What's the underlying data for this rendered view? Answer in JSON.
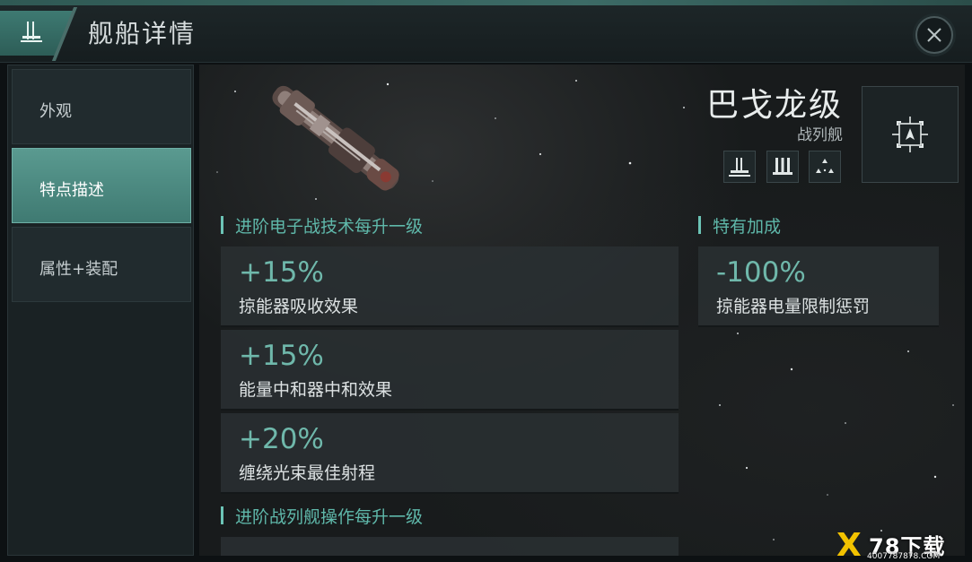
{
  "window": {
    "title": "舰船详情",
    "emblem_icon": "battleship-class-emblem-icon",
    "close_icon": "close-icon"
  },
  "sidebar": {
    "tabs": [
      {
        "label": "外观",
        "active": false
      },
      {
        "label": "特点描述",
        "active": true
      },
      {
        "label": "属性+装配",
        "active": false
      }
    ]
  },
  "ship": {
    "name": "巴戈龙级",
    "class": "战列舰",
    "role_icons": [
      "battleship-silhouette-icon",
      "triple-hull-icon",
      "fleet-formation-icon"
    ],
    "nav_icon": "target-navigate-icon"
  },
  "sections": {
    "skill_bonus_1": {
      "heading": "进阶电子战技术每升一级",
      "bonuses": [
        {
          "value": "+15%",
          "desc": "掠能器吸收效果"
        },
        {
          "value": "+15%",
          "desc": "能量中和器中和效果"
        },
        {
          "value": "+20%",
          "desc": "缠绕光束最佳射程"
        }
      ]
    },
    "role_bonus": {
      "heading": "特有加成",
      "bonuses": [
        {
          "value": "-100%",
          "desc": "掠能器电量限制惩罚"
        }
      ]
    },
    "skill_bonus_2": {
      "heading": "进阶战列舰操作每升一级"
    }
  },
  "watermark": {
    "mark": "X",
    "logo": "78下载",
    "url": "4007787878.COM"
  },
  "colors": {
    "accent": "#5fb8aa",
    "active_tab": "#4f8c84",
    "panel": "#2a3032"
  }
}
